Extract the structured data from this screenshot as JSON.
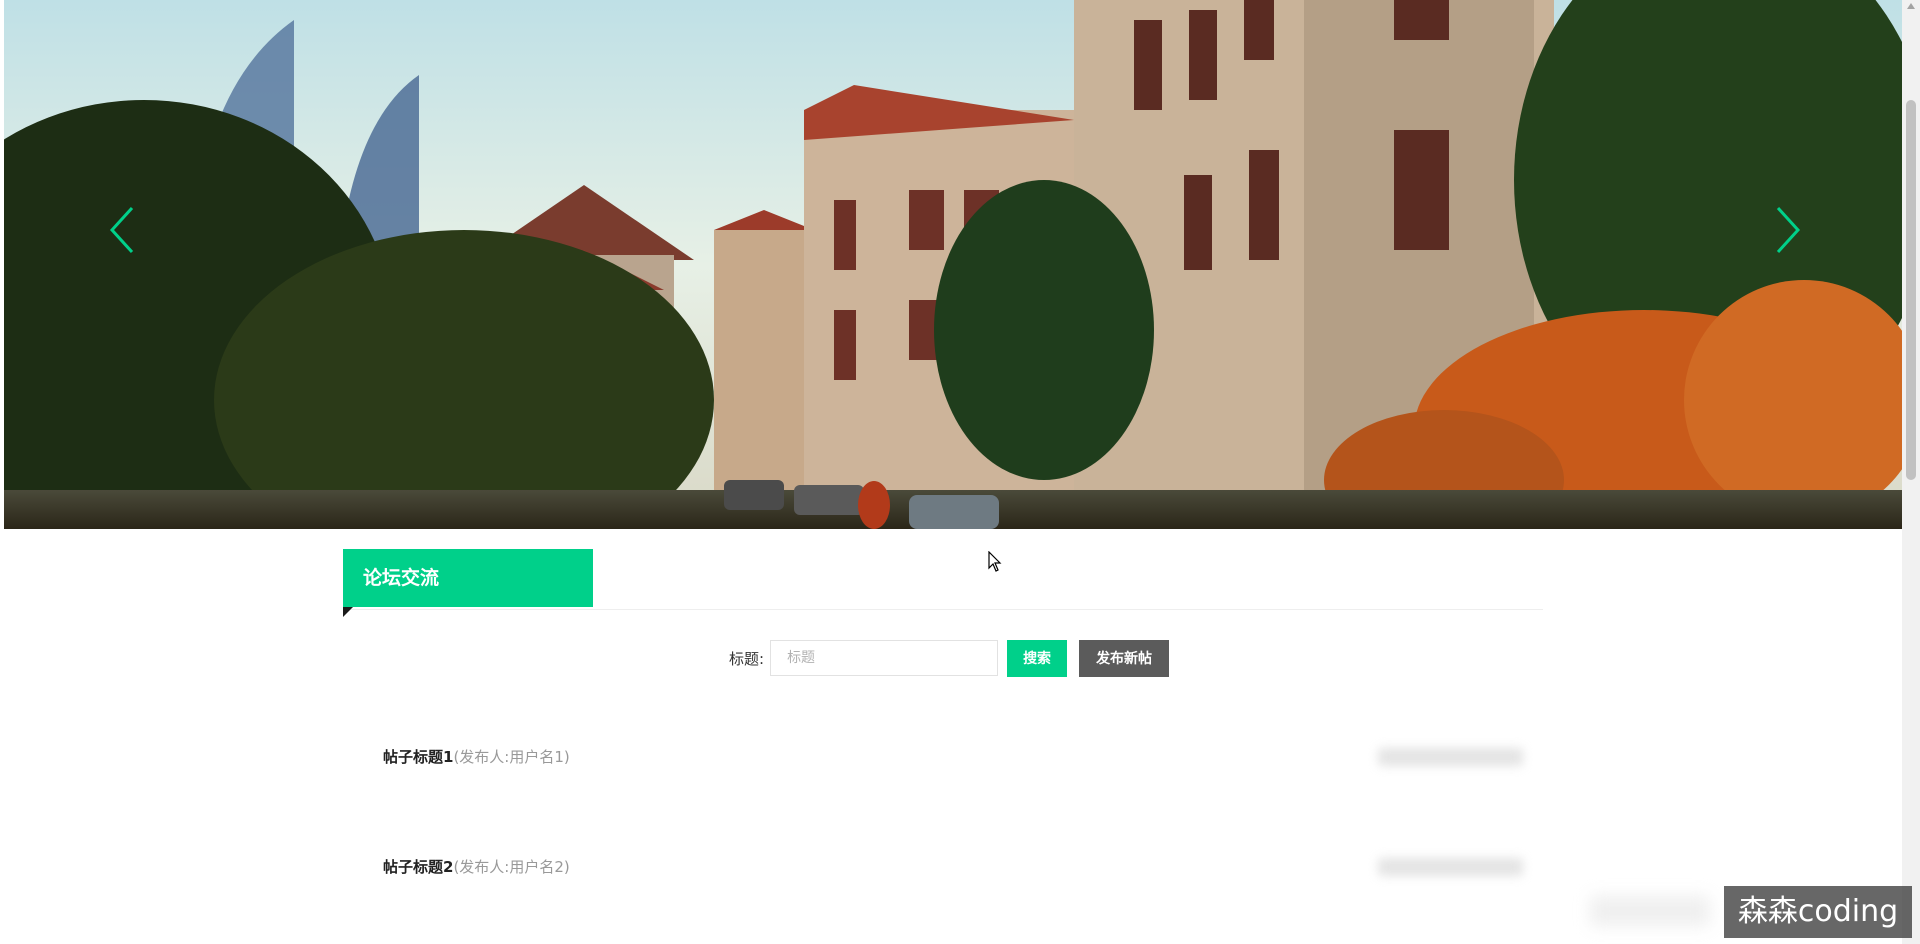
{
  "carousel": {
    "prev_icon": "chevron-left-icon",
    "next_icon": "chevron-right-icon",
    "accent_color": "#00d08a"
  },
  "forum": {
    "section_title": "论坛交流",
    "search": {
      "label": "标题:",
      "placeholder": "标题",
      "value": ""
    },
    "buttons": {
      "search": "搜索",
      "new_post": "发布新帖"
    },
    "posts": [
      {
        "title": "帖子标题1",
        "author": "(发布人:用户名1)"
      },
      {
        "title": "帖子标题2",
        "author": "(发布人:用户名2)"
      }
    ]
  },
  "watermark": {
    "text": "森森coding"
  },
  "colors": {
    "accent": "#00d08a",
    "dark_button": "#5b5b5b"
  }
}
